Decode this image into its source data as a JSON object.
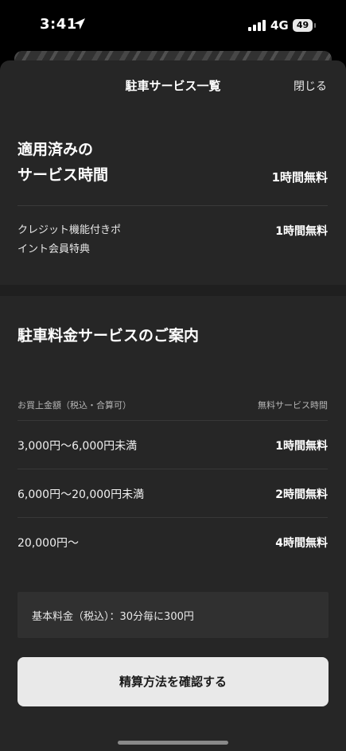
{
  "status_bar": {
    "time": "3:41",
    "network": "4G",
    "battery": "49"
  },
  "sheet": {
    "title": "駐車サービス一覧",
    "close_label": "閉じる"
  },
  "applied": {
    "title_line1": "適用済みの",
    "title_line2": "サービス時間",
    "total": "1時間無料",
    "item_label_line1": "クレジット機能付きポ",
    "item_label_line2": "イント会員特典",
    "item_value": "1時間無料"
  },
  "guide": {
    "title": "駐車料金サービスのご案内",
    "col_left": "お買上金額（税込・合算可）",
    "col_right": "無料サービス時間",
    "rows": [
      {
        "amount": "3,000円〜6,000円未満",
        "free_time": "1時間無料"
      },
      {
        "amount": "6,000円〜20,000円未満",
        "free_time": "2時間無料"
      },
      {
        "amount": "20,000円〜",
        "free_time": "4時間無料"
      }
    ],
    "base_fee": "基本料金（税込）：30分毎に300円"
  },
  "confirm_button": "精算方法を確認する",
  "icons": {
    "location": "location-arrow-icon",
    "signal": "cellular-signal-icon",
    "battery": "battery-icon"
  }
}
